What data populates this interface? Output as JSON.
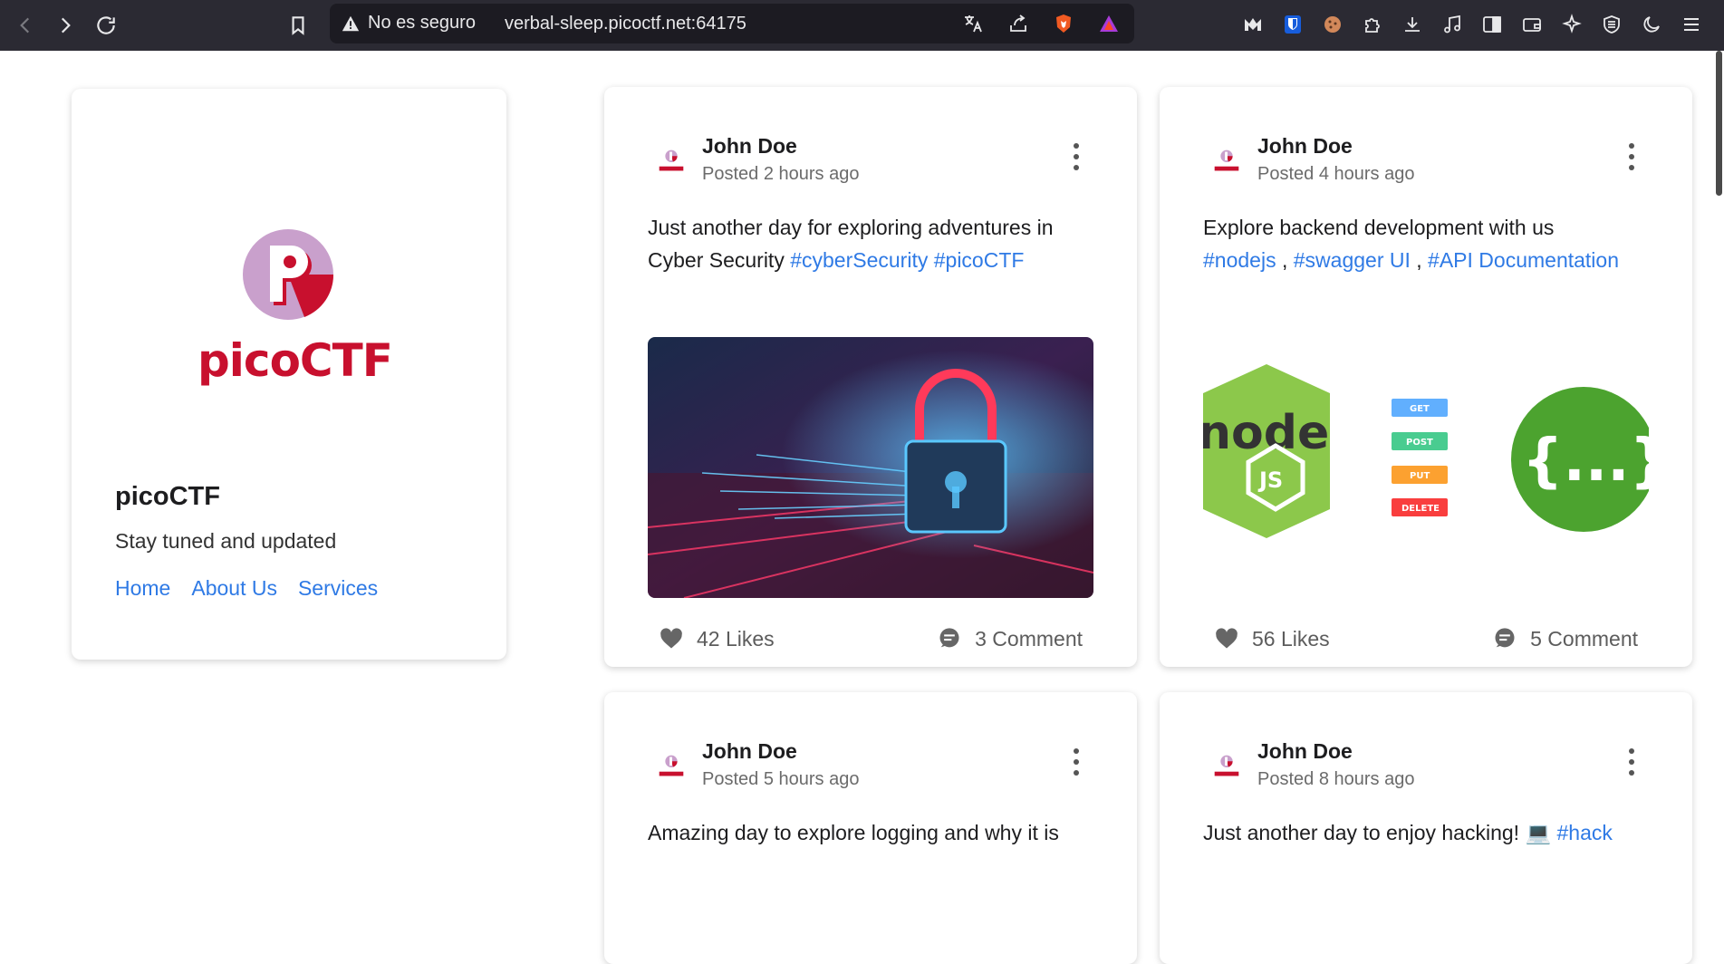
{
  "browser": {
    "security_label": "No es seguro",
    "url": "verbal-sleep.picoctf.net:64175",
    "nav_icons": [
      "back-icon",
      "forward-icon",
      "reload-icon",
      "bookmark-icon"
    ],
    "url_icons": [
      "translate-icon",
      "share-icon",
      "brave-shields-icon",
      "brave-rewards-icon"
    ],
    "extension_icons": [
      "m-extension-icon",
      "bitwarden-icon",
      "cookie-icon",
      "puzzle-icon",
      "download-icon",
      "music-icon",
      "sidebar-icon",
      "wallet-icon",
      "leo-icon",
      "vpn-icon",
      "dark-mode-icon",
      "menu-icon"
    ]
  },
  "profile": {
    "logo_text": "picoCTF",
    "name": "picoCTF",
    "tagline": "Stay tuned and updated",
    "nav": [
      "Home",
      "About Us",
      "Services"
    ]
  },
  "posts": [
    {
      "author": "John Doe",
      "time": "Posted 2 hours ago",
      "text": "Just another day for exploring adventures in Cyber Security ",
      "tags": [
        "#cyberSecurity",
        "#picoCTF"
      ],
      "image": "cyber-lock-image",
      "likes": "42 Likes",
      "comments": "3 Comment"
    },
    {
      "author": "John Doe",
      "time": "Posted 4 hours ago",
      "text": "Explore backend development with us ",
      "tags": [
        "#nodejs",
        "#swagger UI",
        "#API Documentation"
      ],
      "image_labels": [
        "node",
        "JS",
        "GET",
        "POST",
        "PUT",
        "DELETE",
        "{...}"
      ],
      "likes": "56 Likes",
      "comments": "5 Comment"
    },
    {
      "author": "John Doe",
      "time": "Posted 5 hours ago",
      "text": "Amazing day to explore logging and why it is"
    },
    {
      "author": "John Doe",
      "time": "Posted 8 hours ago",
      "text": "Just another day to enjoy hacking! 💻 ",
      "tags": [
        "#hack"
      ]
    }
  ],
  "colors": {
    "brand_red": "#c8102e",
    "link_blue": "#2f7ae5",
    "chrome_bg": "#2b2a33"
  }
}
